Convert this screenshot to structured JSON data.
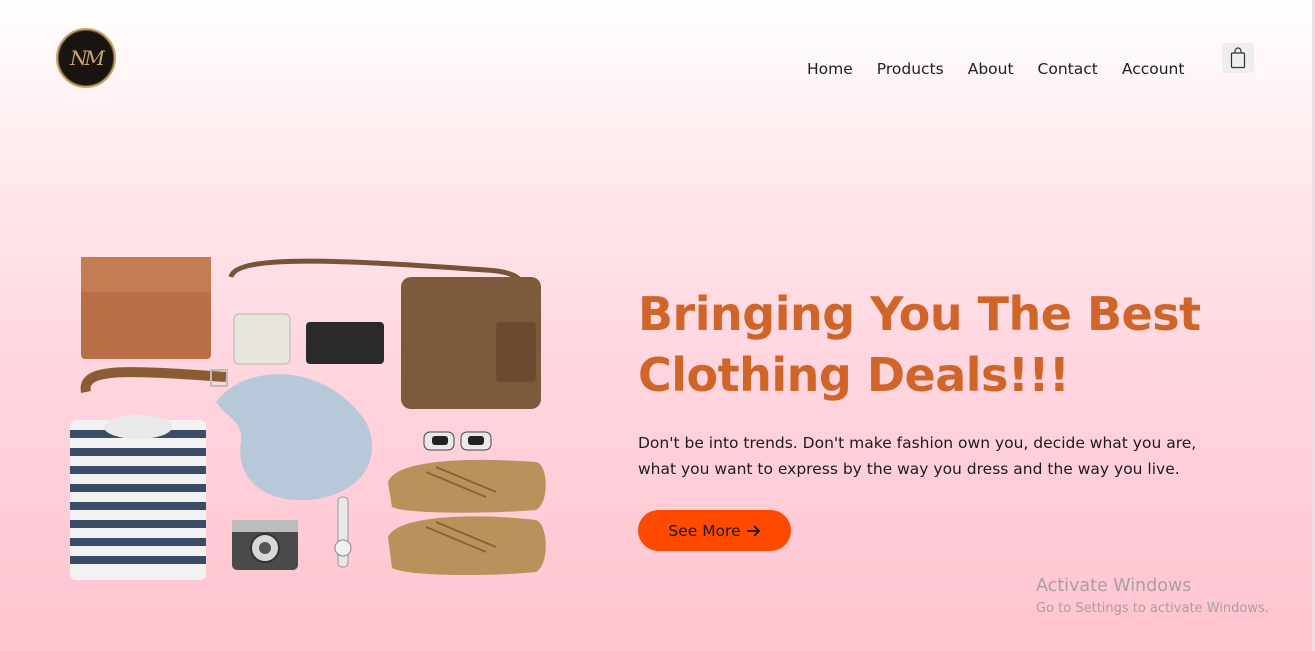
{
  "header": {
    "logo_text": "NM",
    "nav": [
      "Home",
      "Products",
      "About",
      "Contact",
      "Account"
    ],
    "cart_icon": "shopping-bag-icon"
  },
  "hero": {
    "headline_line1": "Bringing You The Best",
    "headline_line2": "Clothing Deals!!!",
    "tagline_line1": "Don't be into trends. Don't make fashion own you, decide what you are,",
    "tagline_line2": "what you want to express by the way you dress and the way you live.",
    "cta_label": "See More",
    "cta_icon": "arrow-right-icon",
    "image_subject": "flat-lay-accessories"
  },
  "watermark": {
    "title": "Activate Windows",
    "subtitle": "Go to Settings to activate Windows."
  },
  "colors": {
    "headline": "#d0652a",
    "cta_bg": "#ff4a00",
    "bg_bottom": "#ffc4d0"
  }
}
